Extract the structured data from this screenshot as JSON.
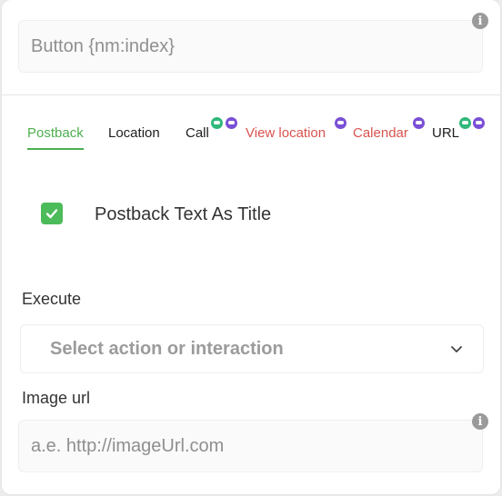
{
  "button_title_field": {
    "value": "Button {nm:index}",
    "info_icon": "info-icon"
  },
  "tabs": [
    {
      "label": "Postback",
      "active": true,
      "color": "#4caf50"
    },
    {
      "label": "Location",
      "active": false,
      "color": "#1e1e1e"
    },
    {
      "label": "Call",
      "active": false,
      "color": "#1e1e1e",
      "badges": [
        "green-chat-badge",
        "purple-chat-badge"
      ]
    },
    {
      "label": "View location",
      "active": false,
      "color": "#d9534f",
      "badges": [
        "purple-chat-badge"
      ]
    },
    {
      "label": "Calendar",
      "active": false,
      "color": "#d9534f",
      "badges": [
        "purple-chat-badge"
      ]
    },
    {
      "label": "URL",
      "active": false,
      "color": "#1e1e1e",
      "badges": [
        "green-chat-badge",
        "purple-chat-badge"
      ]
    }
  ],
  "postback_title_checkbox": {
    "label": "Postback Text As Title",
    "checked": true,
    "color": "#4cbb5a"
  },
  "execute": {
    "label": "Execute",
    "placeholder": "Select action or interaction",
    "icon": "chevron-down-icon"
  },
  "image_url": {
    "label": "Image url",
    "placeholder": "a.e. http://imageUrl.com",
    "info_icon": "info-icon"
  }
}
